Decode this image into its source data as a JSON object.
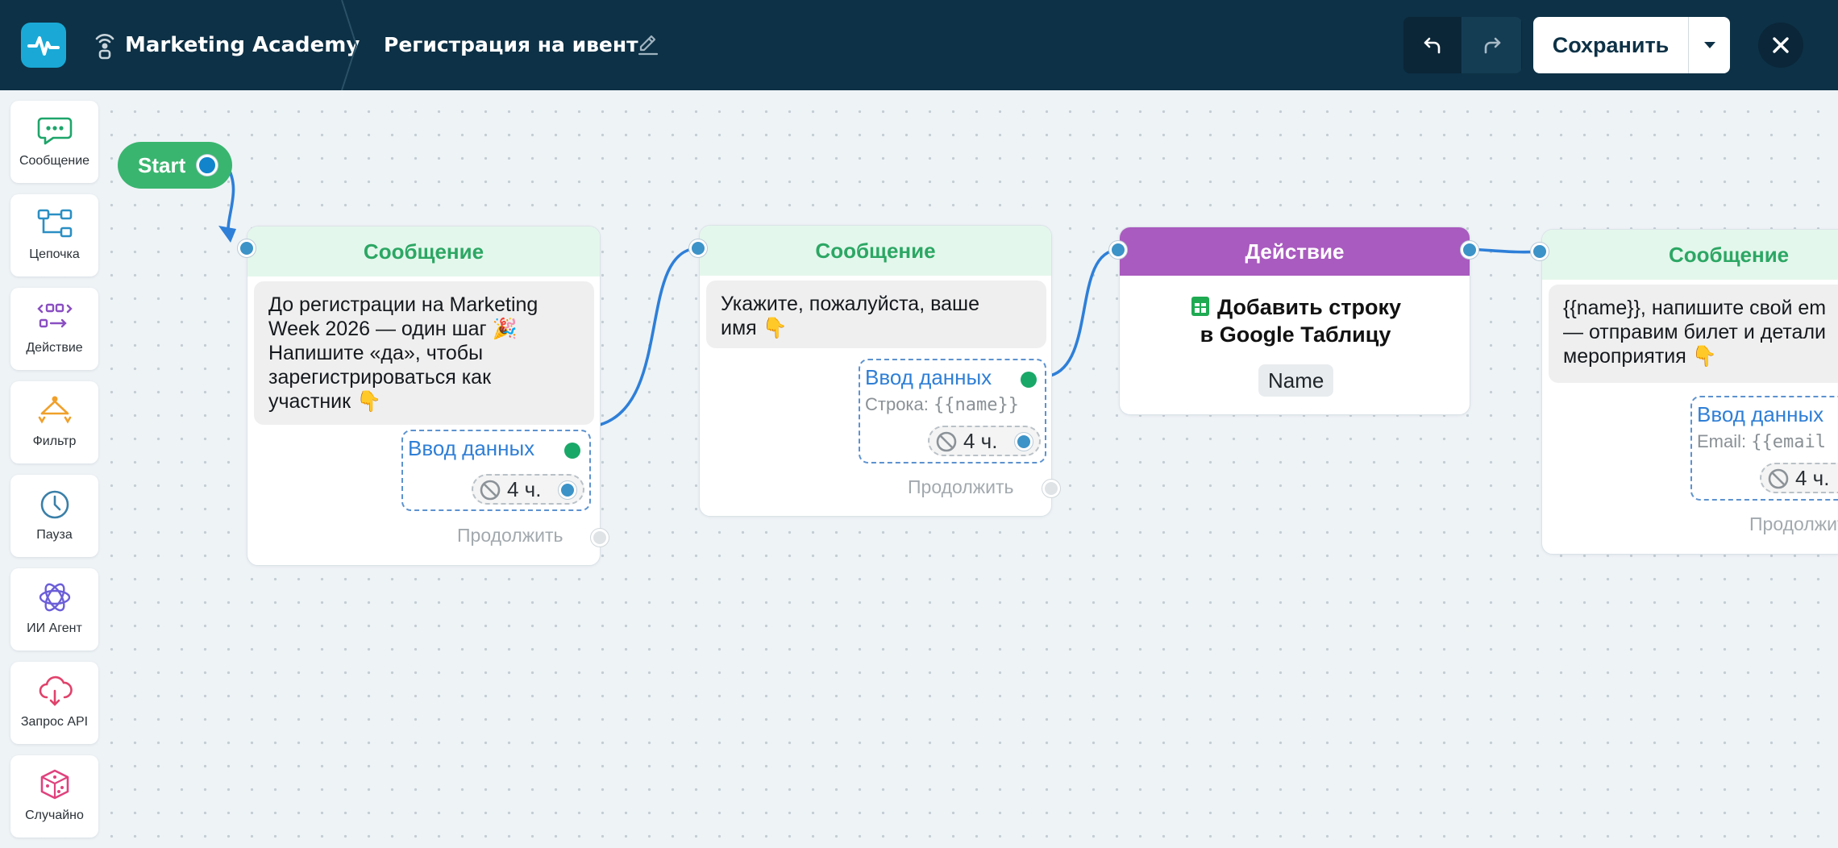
{
  "header": {
    "bot_name": "Marketing Academy",
    "flow_title": "Регистрация на ивент",
    "save_label": "Сохранить"
  },
  "palette": [
    {
      "label": "Сообщение",
      "icon": "chat-bubble-icon",
      "color": "#1ea56a"
    },
    {
      "label": "Цепочка",
      "icon": "chain-icon",
      "color": "#2a8fc4"
    },
    {
      "label": "Действие",
      "icon": "action-icon",
      "color": "#8a4fc2"
    },
    {
      "label": "Фильтр",
      "icon": "filter-icon",
      "color": "#f0a02a"
    },
    {
      "label": "Пауза",
      "icon": "clock-icon",
      "color": "#3a7fa8"
    },
    {
      "label": "ИИ Агент",
      "icon": "ai-agent-icon",
      "color": "#6b5ed8"
    },
    {
      "label": "Запрос API",
      "icon": "cloud-api-icon",
      "color": "#e0426b"
    },
    {
      "label": "Случайно",
      "icon": "dice-icon",
      "color": "#e0427d"
    }
  ],
  "canvas": {
    "start_label": "Start",
    "nodes": [
      {
        "type": "Сообщение",
        "message_lines": [
          "До регистрации на Marketing",
          "Week 2026 — один шаг 🎉",
          "Напишите «да», чтобы",
          "зарегистрироваться как",
          "участник 👇"
        ],
        "input_title": "Ввод данных",
        "timer": "4 ч.",
        "continue_label": "Продолжить"
      },
      {
        "type": "Сообщение",
        "message_lines": [
          "Укажите, пожалуйста, ваше",
          "имя 👇"
        ],
        "input_title": "Ввод данных",
        "var_label": "Строка:",
        "var_code": "{{name}}",
        "timer": "4 ч.",
        "continue_label": "Продолжить"
      },
      {
        "type": "Действие",
        "action_line1": "Добавить строку",
        "action_line2": "в Google Таблицу",
        "chip": "Name"
      },
      {
        "type": "Сообщение",
        "message_lines": [
          "{{name}}, напишите свой em",
          "— отправим билет и детали",
          "мероприятия 👇"
        ],
        "input_title": "Ввод данных",
        "var_label": "Email:",
        "var_code": "{{email",
        "timer": "4 ч.",
        "continue_label": "Продолжить"
      }
    ]
  },
  "colors": {
    "header_bg": "#0d3146",
    "accent_green": "#2ca764",
    "action_purple": "#a95bbf",
    "link_blue": "#2f7fd6",
    "edge_blue": "#2e7fd8"
  }
}
